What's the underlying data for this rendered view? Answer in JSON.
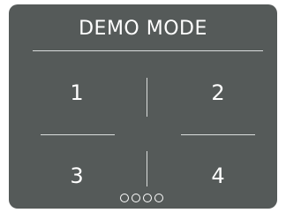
{
  "screen": {
    "title": "DEMO MODE",
    "options": [
      {
        "label": "1"
      },
      {
        "label": "2"
      },
      {
        "label": "3"
      },
      {
        "label": "4"
      }
    ],
    "page_indicator": {
      "count": 4,
      "active": null
    }
  },
  "colors": {
    "background": "#555a59",
    "text": "#ffffff",
    "divider": "#d9dcdc"
  }
}
